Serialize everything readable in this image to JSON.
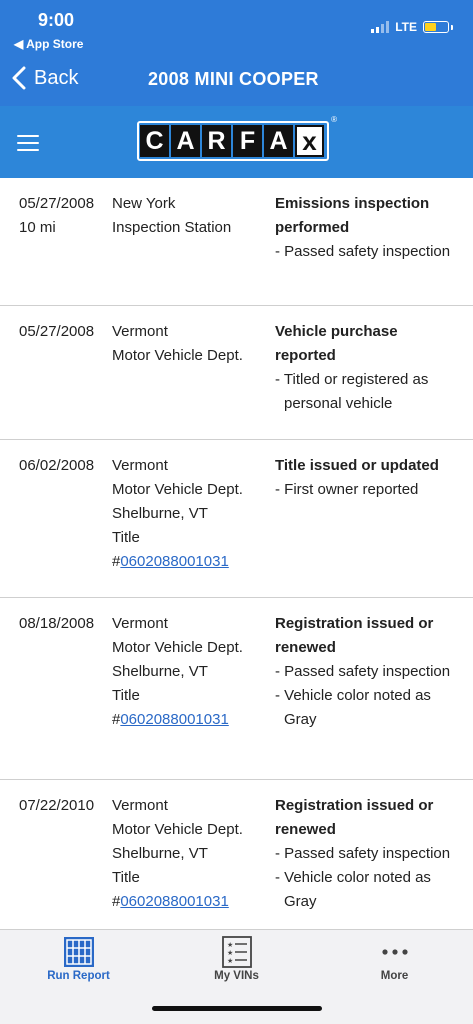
{
  "status": {
    "time": "9:00",
    "back_app": "◀ App Store",
    "network": "LTE",
    "battery_level": 0.45,
    "battery_color": "#ffd21f"
  },
  "nav": {
    "back_label": "Back",
    "title": "2008 MINI COOPER"
  },
  "brand": {
    "logo_letters": [
      "C",
      "A",
      "R",
      "F",
      "A",
      "x"
    ],
    "registered": "®",
    "bar_color": "#2d86d9"
  },
  "records": [
    {
      "date": "05/27/2008",
      "mileage": "10 mi",
      "source_lines": [
        "New York",
        "Inspection Station"
      ],
      "title_prefix": "",
      "title_number": "",
      "event_title": "Emissions inspection performed",
      "details": [
        "- Passed safety inspection"
      ]
    },
    {
      "date": "05/27/2008",
      "mileage": "",
      "source_lines": [
        "Vermont",
        "Motor Vehicle Dept."
      ],
      "title_prefix": "",
      "title_number": "",
      "event_title": "Vehicle purchase reported",
      "details": [
        "- Titled or registered as personal vehicle"
      ]
    },
    {
      "date": "06/02/2008",
      "mileage": "",
      "source_lines": [
        "Vermont",
        "Motor Vehicle Dept.",
        "Shelburne, VT",
        "Title"
      ],
      "title_prefix": "#",
      "title_number": "0602088001031",
      "event_title": "Title issued or updated",
      "details": [
        "- First owner reported"
      ]
    },
    {
      "date": "08/18/2008",
      "mileage": "",
      "source_lines": [
        "Vermont",
        "Motor Vehicle Dept.",
        "Shelburne, VT",
        "Title"
      ],
      "title_prefix": "#",
      "title_number": "0602088001031",
      "event_title": "Registration issued or renewed",
      "details": [
        "- Passed safety inspection",
        "- Vehicle color noted as Gray"
      ]
    },
    {
      "date": "07/22/2010",
      "mileage": "",
      "source_lines": [
        "Vermont",
        "Motor Vehicle Dept.",
        "Shelburne, VT",
        "Title"
      ],
      "title_prefix": "#",
      "title_number": "0602088001031",
      "event_title": "Registration issued or renewed",
      "details": [
        "- Passed safety inspection",
        "- Vehicle color noted as Gray"
      ]
    }
  ],
  "tabs": [
    {
      "label": "Run Report",
      "icon": "run-report-icon",
      "active": true,
      "color": "#2a69c7"
    },
    {
      "label": "My VINs",
      "icon": "my-vins-icon",
      "active": false,
      "color": "#444444"
    },
    {
      "label": "More",
      "icon": "more-icon",
      "active": false,
      "color": "#444444"
    }
  ]
}
